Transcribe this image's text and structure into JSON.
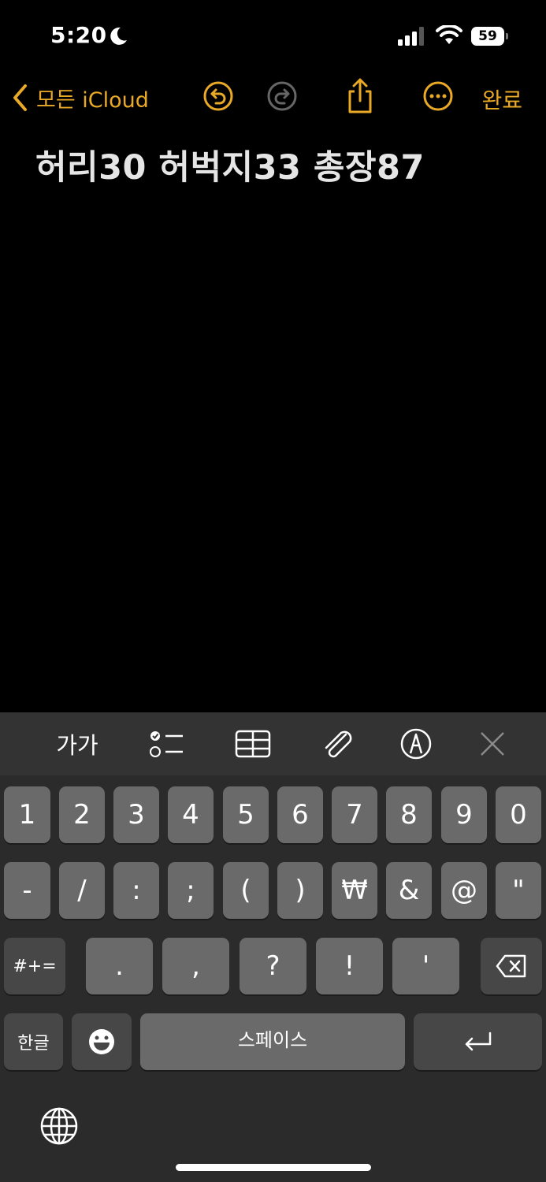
{
  "status_bar": {
    "time": "5:20",
    "battery": "59"
  },
  "nav": {
    "back_label": "모든 iCloud",
    "done_label": "완료",
    "accent_color": "#e9a926",
    "icons": [
      "undo-icon",
      "redo-icon",
      "share-icon",
      "more-icon"
    ]
  },
  "note": {
    "text": "허리30 허벅지33 총장87"
  },
  "keyboard_toolbar": {
    "format_label": "가가",
    "icons": [
      "checklist-icon",
      "table-icon",
      "attachment-icon",
      "markup-icon",
      "close-icon"
    ]
  },
  "keyboard": {
    "row1": [
      "1",
      "2",
      "3",
      "4",
      "5",
      "6",
      "7",
      "8",
      "9",
      "0"
    ],
    "row2": [
      "-",
      "/",
      ":",
      ";",
      "(",
      ")",
      "₩",
      "&",
      "@",
      "\""
    ],
    "row3": {
      "mode": "#+=",
      "keys": [
        ".",
        ",",
        "?",
        "!",
        "'"
      ]
    },
    "row4": {
      "lang": "한글",
      "space": "스페이스"
    }
  }
}
